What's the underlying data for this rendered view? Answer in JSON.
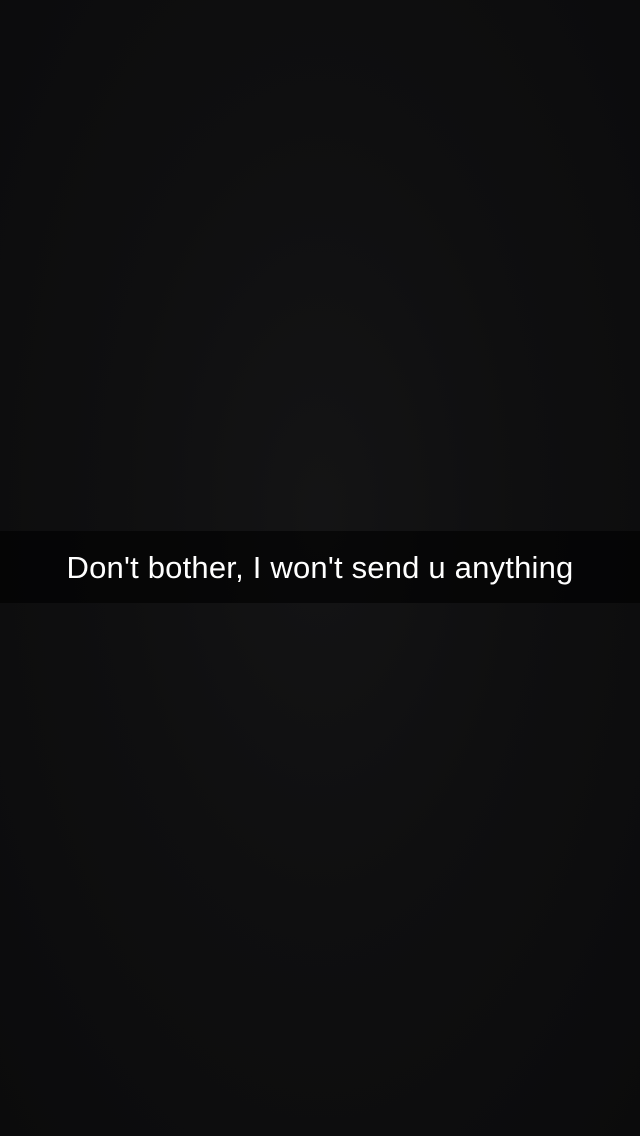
{
  "snap": {
    "caption": "Don't bother, I won't send u anything"
  },
  "colors": {
    "background": "#0e0e0f",
    "caption_bar": "rgba(0,0,0,0.6)",
    "caption_text": "#ffffff"
  }
}
